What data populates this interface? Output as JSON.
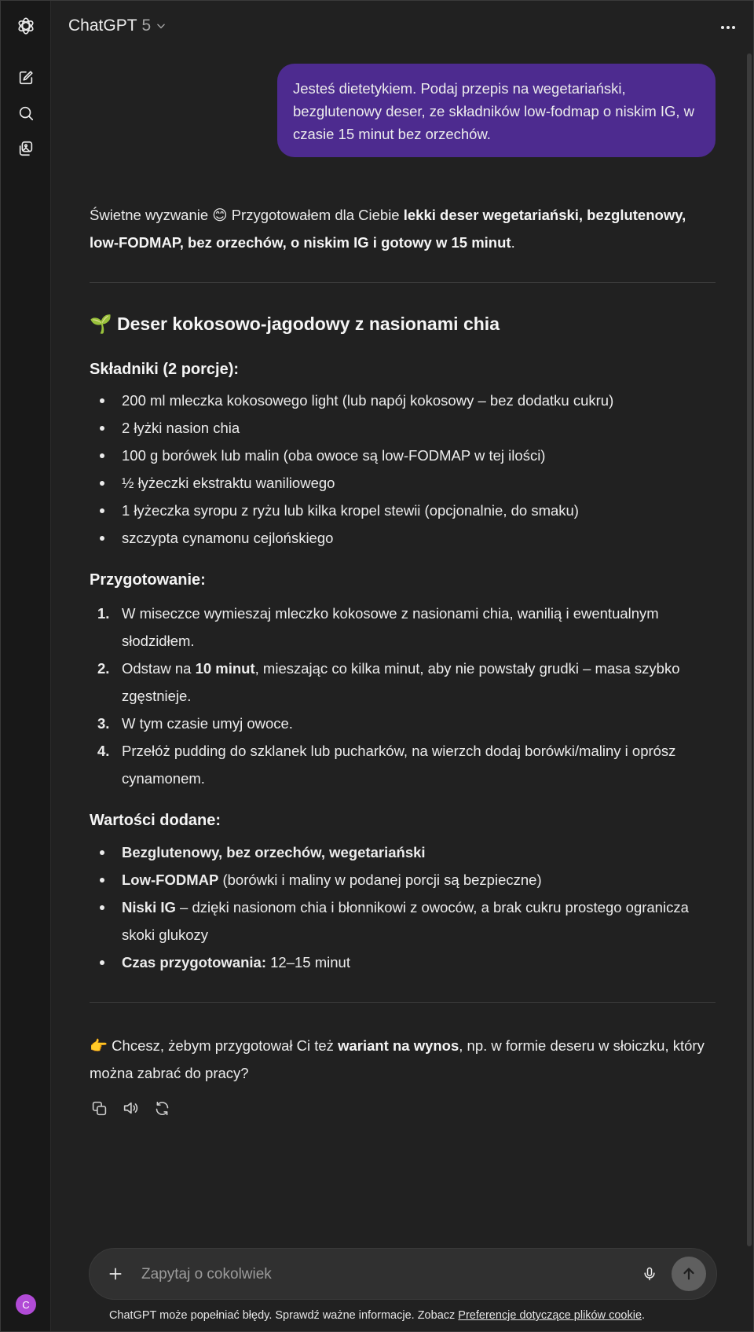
{
  "header": {
    "model_name": "ChatGPT",
    "model_version": "5"
  },
  "user_message": "Jesteś dietetykiem. Podaj przepis na wegetariański, bezglutenowy deser, ze składników low-fodmap o niskim IG, w czasie 15 minut bez orzechów.",
  "assistant": {
    "intro_plain": "Świetne wyzwanie 😊 Przygotowałem dla Ciebie ",
    "intro_bold": "lekki deser wegetariański, bezglutenowy, low-FODMAP, bez orzechów, o niskim IG i gotowy w 15 minut",
    "intro_end": ".",
    "recipe_title": "🌱 Deser kokosowo-jagodowy z nasionami chia",
    "ingredients_heading": "Składniki (2 porcje):",
    "ingredients": [
      "200 ml mleczka kokosowego light (lub napój kokosowy – bez dodatku cukru)",
      "2 łyżki nasion chia",
      "100 g borówek lub malin (oba owoce są low-FODMAP w tej ilości)",
      "½ łyżeczki ekstraktu waniliowego",
      "1 łyżeczka syropu z ryżu lub kilka kropel stewii (opcjonalnie, do smaku)",
      "szczypta cynamonu cejlońskiego"
    ],
    "prep_heading": "Przygotowanie:",
    "steps": [
      {
        "num": "1.",
        "text": "W miseczce wymieszaj mleczko kokosowe z nasionami chia, wanilią i ewentualnym słodzidłem."
      },
      {
        "num": "2.",
        "pre": "Odstaw na ",
        "bold": "10 minut",
        "post": ", mieszając co kilka minut, aby nie powstały grudki – masa szybko zgęstnieje."
      },
      {
        "num": "3.",
        "text": "W tym czasie umyj owoce."
      },
      {
        "num": "4.",
        "text": "Przełóż pudding do szklanek lub pucharków, na wierzch dodaj borówki/maliny i oprósz cynamonem."
      }
    ],
    "values_heading": "Wartości dodane:",
    "values": [
      {
        "bold": "Bezglutenowy, bez orzechów, wegetariański",
        "text": ""
      },
      {
        "bold": "Low-FODMAP",
        "text": " (borówki i maliny w podanej porcji są bezpieczne)"
      },
      {
        "bold": "Niski IG",
        "text": " – dzięki nasionom chia i błonnikowi z owoców, a brak cukru prostego ogranicza skoki glukozy"
      },
      {
        "bold": "Czas przygotowania:",
        "text": " 12–15 minut"
      }
    ],
    "followup_pre": "👉 Chcesz, żebym przygotował Ci też ",
    "followup_bold": "wariant na wynos",
    "followup_post": ", np. w formie deseru w słoiczku, który można zabrać do pracy?"
  },
  "composer": {
    "placeholder": "Zapytaj o cokolwiek"
  },
  "footer": {
    "text": "ChatGPT może popełniać błędy. Sprawdź ważne informacje. Zobacz ",
    "link": "Preferencje dotyczące plików cookie",
    "end": "."
  },
  "avatar_letter": "C",
  "colors": {
    "user_bubble": "#4d2b8f",
    "background": "#212121",
    "sidebar": "#181818",
    "avatar": "#b14bd6"
  }
}
